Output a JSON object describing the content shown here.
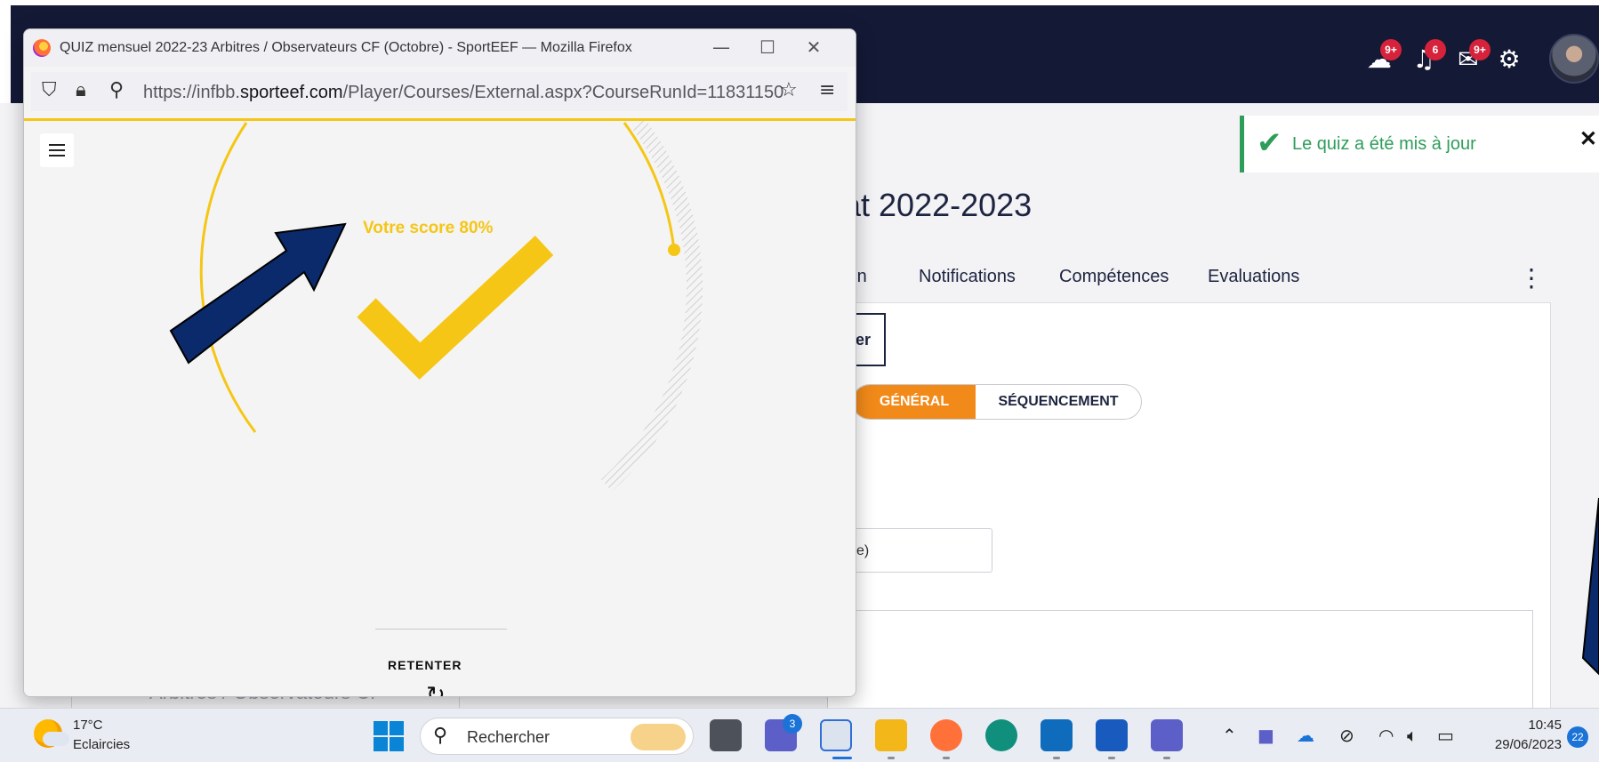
{
  "background_app": {
    "toast_message": "Le quiz a été mis à jour",
    "heading": "at 2022-2023",
    "tabs": [
      "ion",
      "Notifications",
      "Compétences",
      "Evaluations"
    ],
    "button_partial": "er",
    "segment_general": "GÉNÉRAL",
    "segment_sequencement": "SÉQUENCEMENT",
    "input_partial": "e)",
    "left_text": "Arbitres / Observateurs CF",
    "badges": {
      "chat": "9+",
      "notifications": "6",
      "mail": "9+"
    },
    "colors": {
      "topbar": "#141936",
      "toast": "#2e9d5a",
      "segment_active": "#f28a1a"
    }
  },
  "firefox": {
    "window_title": "QUIZ mensuel 2022-23 Arbitres / Observateurs CF (Octobre) - SportEEF — Mozilla Firefox",
    "url_prefix": "https://infbb.",
    "url_domain": "sporteef.com",
    "url_path": "/Player/Courses/External.aspx?CourseRunId=11831150",
    "score_text": "Votre score 80%",
    "retry_label": "RETENTER",
    "score": 0.8,
    "colors": {
      "accent": "#f5c615"
    }
  },
  "annotation": {
    "arrow_color": "#0a2a6b"
  },
  "taskbar": {
    "temperature": "17°C",
    "weather": "Eclaircies",
    "search_placeholder": "Rechercher",
    "time": "10:45",
    "date": "29/06/2023",
    "notification_count": "22",
    "meet_badge": "3"
  }
}
